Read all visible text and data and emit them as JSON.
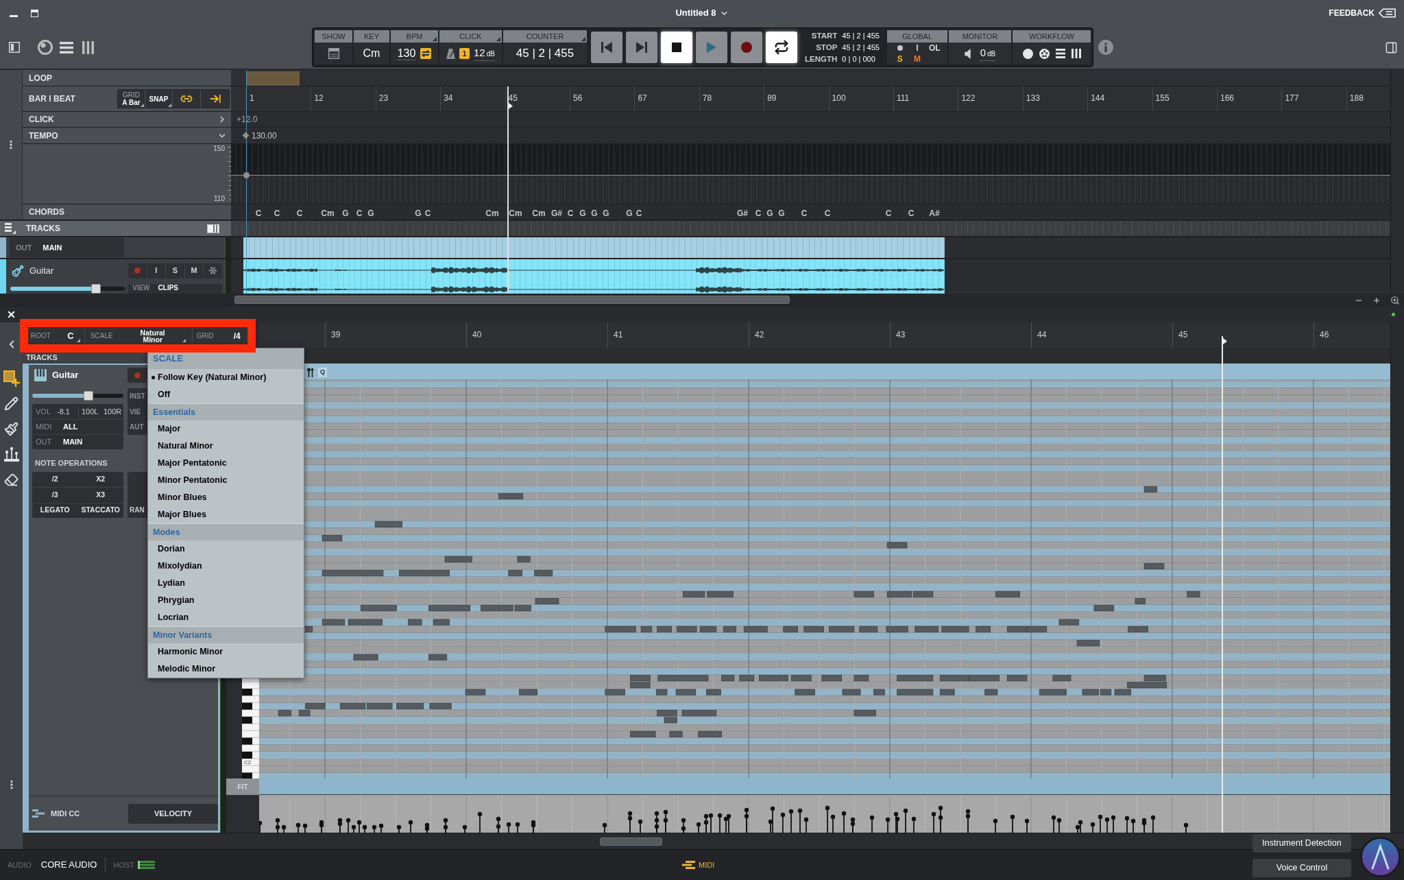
{
  "window": {
    "title": "Untitled 8",
    "feedback": "FEEDBACK"
  },
  "transport": {
    "sections": [
      {
        "kind": "show",
        "label": "SHOW"
      },
      {
        "kind": "key",
        "label": "KEY",
        "value": "Cm"
      },
      {
        "kind": "bpm",
        "label": "BPM",
        "value": "130"
      },
      {
        "kind": "click",
        "label": "CLICK",
        "value": "1",
        "reading": "12",
        "unit": "dB"
      },
      {
        "kind": "counter",
        "label": "COUNTER",
        "value": "45 | 2 | 455"
      }
    ],
    "buttons": [
      {
        "kind": "rewind",
        "active": false
      },
      {
        "kind": "forward",
        "active": false
      },
      {
        "kind": "stop",
        "active": true
      },
      {
        "kind": "play",
        "active": false
      },
      {
        "kind": "record",
        "active": false
      },
      {
        "kind": "loop",
        "active": true
      }
    ],
    "positions": [
      {
        "label": "START",
        "value": "45 | 2 | 455"
      },
      {
        "label": "STOP",
        "value": "45 | 2 | 455"
      },
      {
        "label": "LENGTH",
        "value": "0 | 0 | 000"
      }
    ],
    "global": {
      "label": "GLOBAL",
      "items": [
        {
          "text": "I",
          "color": "#d9d9d9"
        },
        {
          "text": "OL",
          "color": "#d9d9d9"
        },
        {
          "text": "S",
          "color": "#f2b630"
        },
        {
          "text": "M",
          "color": "#f0772e"
        }
      ]
    },
    "monitor": {
      "label": "MONITOR",
      "value": "0",
      "unit": "dB"
    },
    "workflow": {
      "label": "WORKFLOW"
    }
  },
  "arranger": {
    "loop": {
      "label": "LOOP"
    },
    "bar_beat": {
      "label": "BAR I BEAT",
      "grid_label": "GRID",
      "grid_value": "A Bar",
      "snap": "SNAP"
    },
    "ruler": [
      "1",
      "12",
      "23",
      "34",
      "45",
      "56",
      "67",
      "78",
      "89",
      "100",
      "111",
      "122",
      "133",
      "144",
      "155",
      "166",
      "177",
      "188"
    ],
    "click": {
      "label": "CLICK",
      "value": "+12.0"
    },
    "tempo": {
      "label": "TEMPO",
      "value": "130.00",
      "scale_max": "150",
      "scale_min": "110"
    },
    "chords": {
      "label": "CHORDS",
      "items": [
        "C",
        "C",
        "C",
        "Cm",
        "G",
        "C",
        "G",
        "G",
        "C",
        "Cm",
        "Cm",
        "Cm",
        "G#",
        "C",
        "G",
        "G",
        "G",
        "G",
        "C",
        "G#",
        "C",
        "G",
        "G",
        "C",
        "C",
        "C",
        "C",
        "A#"
      ]
    },
    "tracks_label": "TRACKS",
    "partial_track": {
      "out_label": "OUT",
      "out_value": "MAIN"
    },
    "track": {
      "name": "Guitar",
      "buttons": [
        "I",
        "S",
        "M"
      ],
      "view_label": "VIEW",
      "view_value": "CLIPS",
      "level": 0.75
    }
  },
  "editor": {
    "header": {
      "highlighted": true,
      "root_label": "ROOT",
      "root": "C",
      "scale_label": "SCALE",
      "scale": "Natural Minor",
      "grid_label": "GRID",
      "grid": "/4"
    },
    "ruler": [
      "39",
      "40",
      "41",
      "42",
      "43",
      "44",
      "45",
      "46"
    ],
    "tracks_label": "TRACKS",
    "inspector": {
      "name": "Guitar",
      "level": 0.62,
      "mix": [
        {
          "label": "VOL",
          "values": [
            "-8.1",
            "100L",
            "100R"
          ]
        },
        {
          "label": "MIDI",
          "values": [
            "ALL"
          ]
        },
        {
          "label": "OUT",
          "values": [
            "MAIN"
          ]
        }
      ],
      "side_labels": [
        "INST",
        "VIE",
        "AUT"
      ],
      "note_operations_title": "NOTE OPERATIONS",
      "note_operations": [
        "/2",
        "X2",
        "/3",
        "X3",
        "LEGATO",
        "STACCATO"
      ],
      "side_operation": "RAN",
      "lane_label": "MIDI CC",
      "lane_button": "VELOCITY"
    },
    "piano_roll": {
      "quantize": "Q",
      "key_label": "C2",
      "fit": "FIT"
    },
    "scale_menu": {
      "title": "SCALE",
      "items": [
        {
          "kind": "option",
          "label": "Follow Key (Natural Minor)",
          "selected": true
        },
        {
          "kind": "option",
          "label": "Off",
          "selected": false
        },
        {
          "kind": "group",
          "label": "Essentials"
        },
        {
          "kind": "option",
          "label": "Major",
          "selected": false
        },
        {
          "kind": "option",
          "label": "Natural Minor",
          "selected": false
        },
        {
          "kind": "option",
          "label": "Major Pentatonic",
          "selected": false
        },
        {
          "kind": "option",
          "label": "Minor Pentatonic",
          "selected": false
        },
        {
          "kind": "option",
          "label": "Minor Blues",
          "selected": false
        },
        {
          "kind": "option",
          "label": "Major Blues",
          "selected": false
        },
        {
          "kind": "group",
          "label": "Modes"
        },
        {
          "kind": "option",
          "label": "Dorian",
          "selected": false
        },
        {
          "kind": "option",
          "label": "Mixolydian",
          "selected": false
        },
        {
          "kind": "option",
          "label": "Lydian",
          "selected": false
        },
        {
          "kind": "option",
          "label": "Phrygian",
          "selected": false
        },
        {
          "kind": "option",
          "label": "Locrian",
          "selected": false
        },
        {
          "kind": "group",
          "label": "Minor Variants"
        },
        {
          "kind": "option",
          "label": "Harmonic Minor",
          "selected": false
        },
        {
          "kind": "option",
          "label": "Melodic Minor",
          "selected": false
        }
      ]
    }
  },
  "status_bar": {
    "audio_label": "AUDIO",
    "audio_device": "CORE AUDIO",
    "host_label": "HOST",
    "midi": "MIDI",
    "actions": [
      "Instrument Detection",
      "Voice Control"
    ]
  }
}
